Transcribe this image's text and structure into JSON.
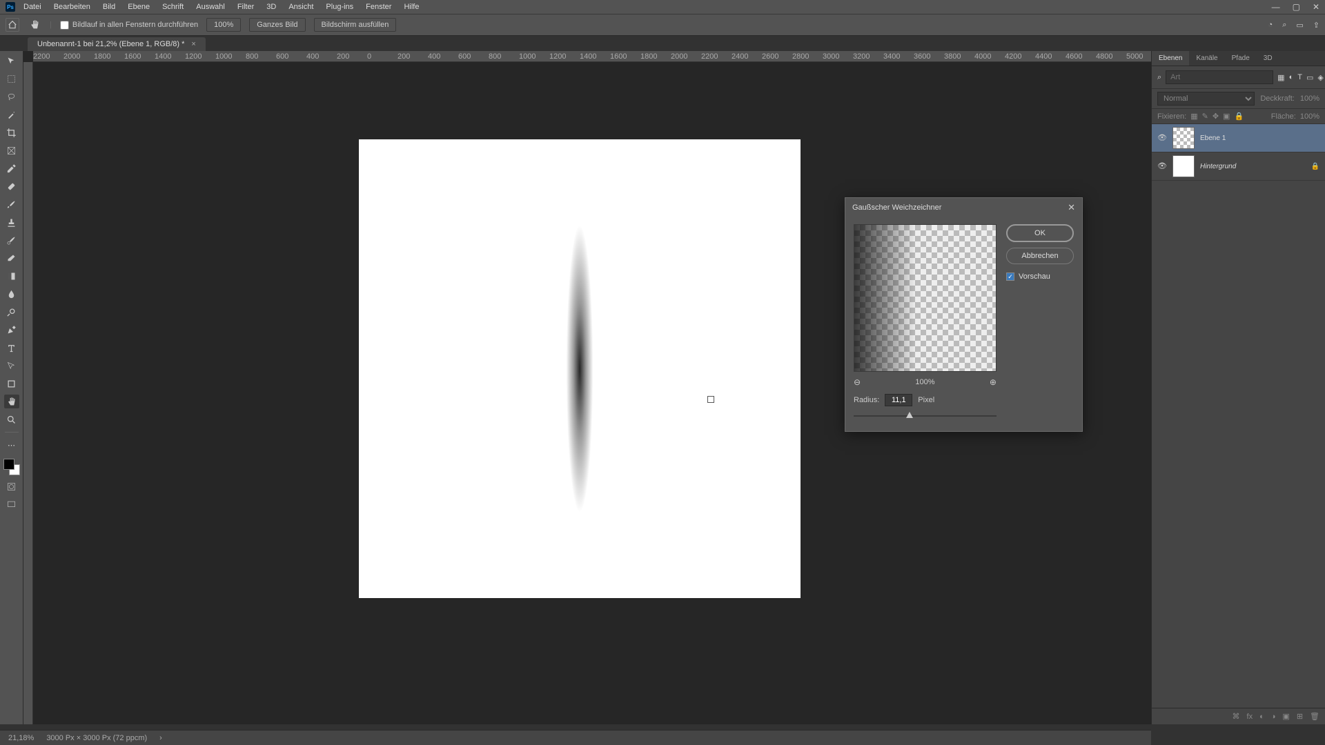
{
  "menu": [
    "Datei",
    "Bearbeiten",
    "Bild",
    "Ebene",
    "Schrift",
    "Auswahl",
    "Filter",
    "3D",
    "Ansicht",
    "Plug-ins",
    "Fenster",
    "Hilfe"
  ],
  "optionbar": {
    "scroll_all": "Bildlauf in allen Fenstern durchführen",
    "zoom100": "100%",
    "fit_all": "Ganzes Bild",
    "fill_screen": "Bildschirm ausfüllen"
  },
  "doctab": {
    "title": "Unbenannt-1 bei 21,2% (Ebene 1, RGB/8) *"
  },
  "ruler_marks": [
    "2200",
    "2000",
    "1800",
    "1600",
    "1400",
    "1200",
    "1000",
    "800",
    "600",
    "400",
    "200",
    "0",
    "200",
    "400",
    "600",
    "800",
    "1000",
    "1200",
    "1400",
    "1600",
    "1800",
    "2000",
    "2200",
    "2400",
    "2600",
    "2800",
    "3000",
    "3200",
    "3400",
    "3600",
    "3800",
    "4000",
    "4200",
    "4400",
    "4600",
    "4800",
    "5000"
  ],
  "dialog": {
    "title": "Gaußscher Weichzeichner",
    "ok": "OK",
    "cancel": "Abbrechen",
    "preview": "Vorschau",
    "zoom": "100%",
    "radius_label": "Radius:",
    "radius_value": "11,1",
    "unit": "Pixel"
  },
  "panels": {
    "tabs": [
      "Ebenen",
      "Kanäle",
      "Pfade",
      "3D"
    ],
    "search_placeholder": "Art",
    "blend_mode": "Normal",
    "opacity_label": "Deckkraft:",
    "opacity_value": "100%",
    "lock_label": "Fixieren:",
    "fill_label": "Fläche:",
    "fill_value": "100%",
    "layers": [
      {
        "name": "Ebene 1",
        "selected": true,
        "checker": true,
        "locked": false
      },
      {
        "name": "Hintergrund",
        "selected": false,
        "checker": false,
        "locked": true
      }
    ]
  },
  "status": {
    "zoom": "21,18%",
    "doc": "3000 Px × 3000 Px (72 ppcm)"
  }
}
